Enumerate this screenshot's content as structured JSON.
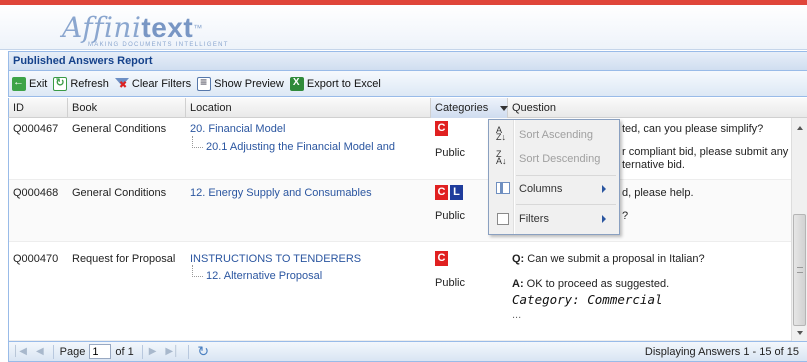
{
  "logo": {
    "light": "Affini",
    "bold": "text",
    "tm": "™",
    "tagline": "MAKING DOCUMENTS INTELLIGENT"
  },
  "panel": {
    "title": "Published Answers Report"
  },
  "toolbar": {
    "exit": "Exit",
    "refresh": "Refresh",
    "clear_filters": "Clear Filters",
    "show_preview": "Show Preview",
    "export_excel": "Export to Excel"
  },
  "columns": [
    "ID",
    "Book",
    "Location",
    "Categories",
    "Question"
  ],
  "rows": [
    {
      "id": "Q000467",
      "book": "General Conditions",
      "location": "20. Financial Model",
      "sublocation": "20.1 Adjusting the Financial Model and",
      "badges": [
        "C"
      ],
      "visibility": "Public",
      "q_line1": "ted, can you please simplify?",
      "q_line2": "r compliant bid, please submit any",
      "q_line3": "ternative bid."
    },
    {
      "id": "Q000468",
      "book": "General Conditions",
      "location": "12. Energy Supply and Consumables",
      "badges": [
        "C",
        "L"
      ],
      "visibility": "Public",
      "q_line1": "d, please help.",
      "q_line2": "?"
    },
    {
      "id": "Q000470",
      "book": "Request for Proposal",
      "location": "INSTRUCTIONS TO TENDERERS",
      "sublocation": "12. Alternative Proposal",
      "badges": [
        "C"
      ],
      "visibility": "Public",
      "q_label": "Q:",
      "q_text": "Can we submit a proposal in Italian?",
      "a_label": "A:",
      "a_text": "OK to proceed as suggested.",
      "category": "Category: Commercial",
      "more": "..."
    }
  ],
  "menu": {
    "sort_asc": "Sort Ascending",
    "sort_desc": "Sort Descending",
    "columns": "Columns",
    "filters": "Filters"
  },
  "pager": {
    "page_label": "Page",
    "page_value": "1",
    "of_label": "of 1",
    "info": "Displaying Answers 1 - 15 of 15"
  },
  "colors": {
    "accent": "#e0463a",
    "header_text": "#15428b",
    "link": "#2b56a0",
    "badge_c": "#e02020",
    "badge_l": "#1f3c9c"
  },
  "icons": [
    "exit-icon",
    "refresh-icon",
    "clear-filter-icon",
    "preview-icon",
    "excel-icon",
    "sort-asc-icon",
    "sort-desc-icon",
    "columns-icon",
    "filter-checkbox-icon"
  ]
}
